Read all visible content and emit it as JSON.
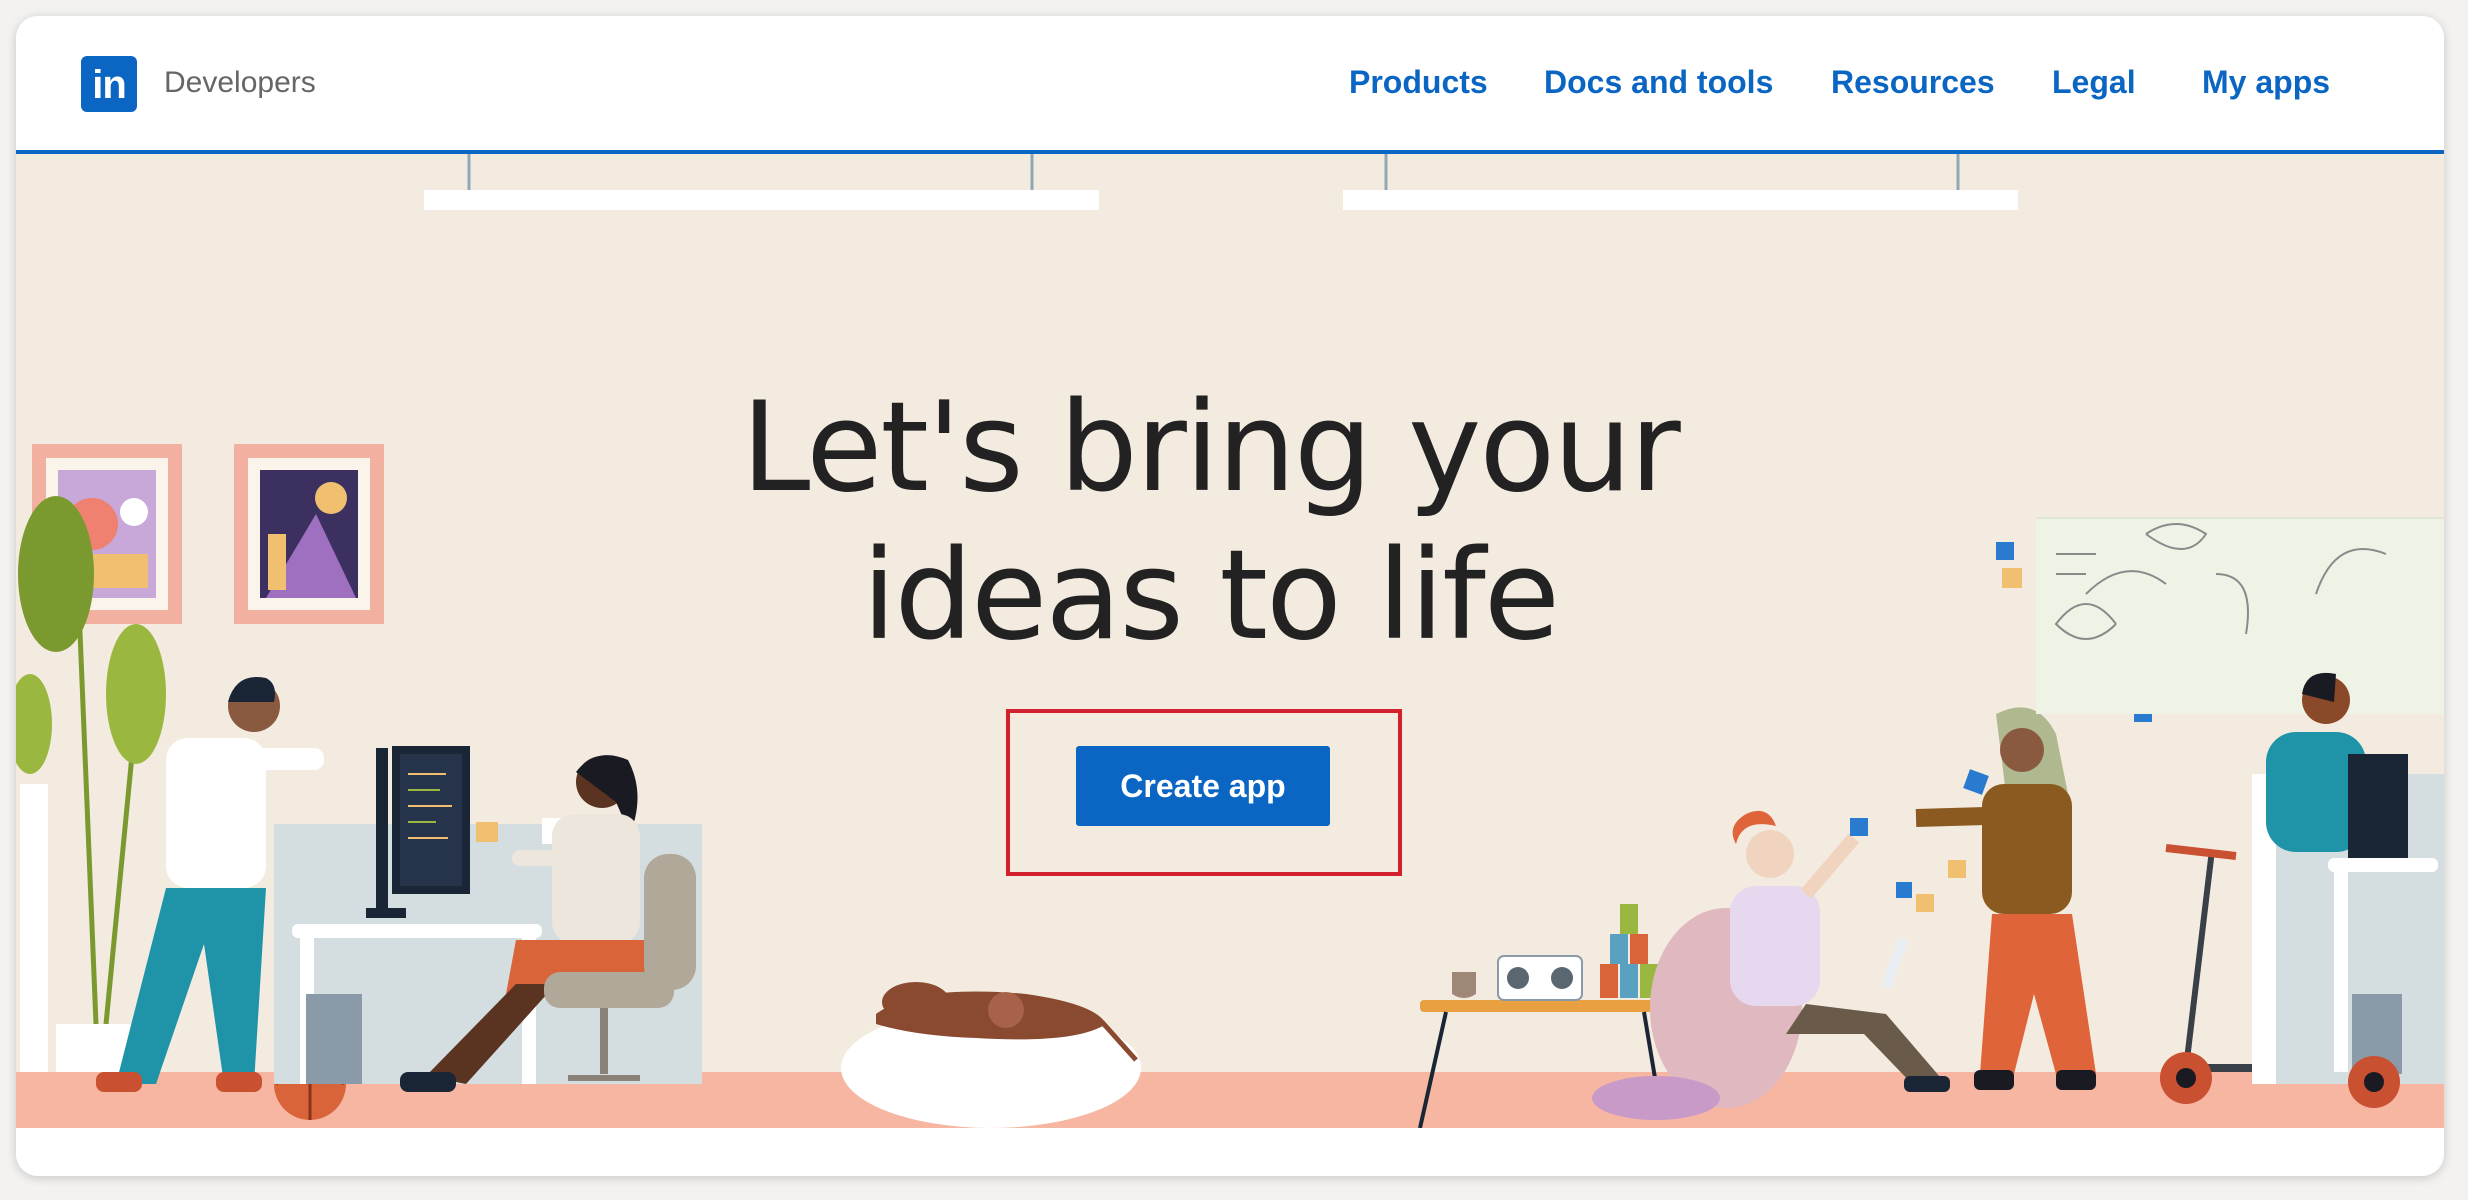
{
  "header": {
    "brand": "Developers",
    "logo_text": "in",
    "nav": [
      "Products",
      "Docs and tools",
      "Resources",
      "Legal",
      "My apps"
    ]
  },
  "hero": {
    "title_line1": "Let's bring your",
    "title_line2": "ideas to life",
    "cta_label": "Create app"
  },
  "colors": {
    "accent": "#0a66c2",
    "hero_background": "#f4ebe0",
    "highlight": "#d2202f"
  }
}
